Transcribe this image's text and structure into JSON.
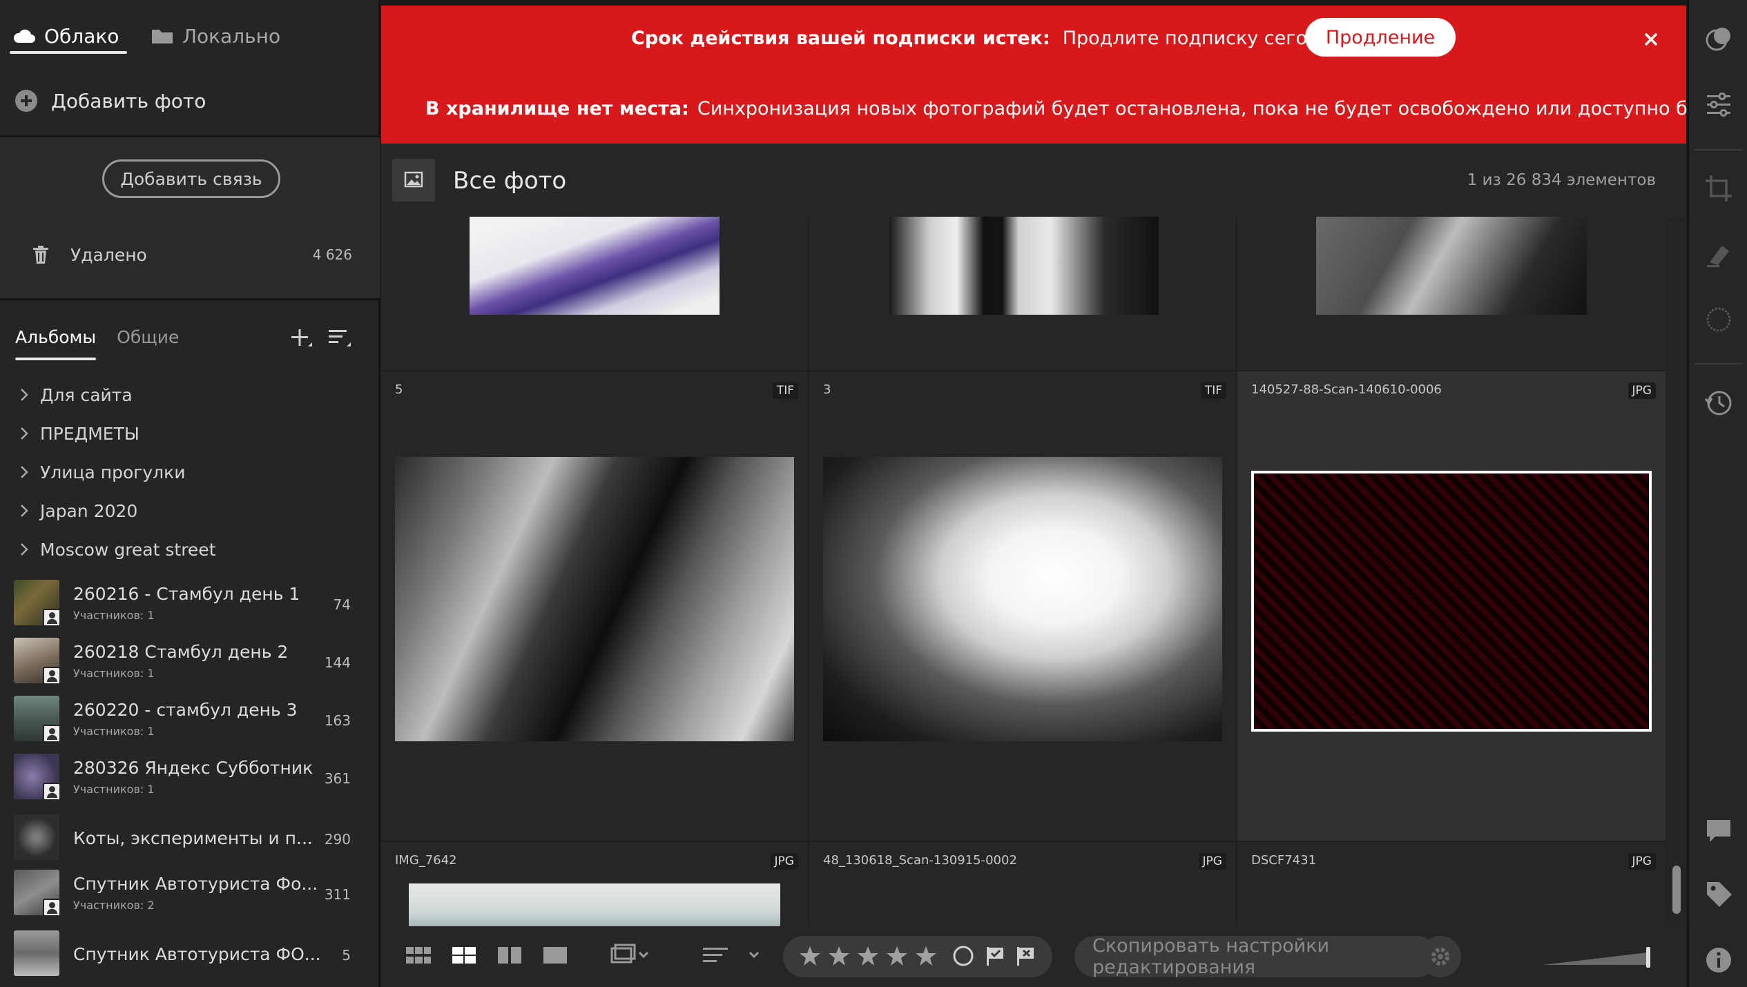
{
  "sidebar": {
    "tabs": [
      {
        "label": "Облако",
        "icon": "cloud-icon",
        "active": true
      },
      {
        "label": "Локально",
        "icon": "folder-icon",
        "active": false
      }
    ],
    "add_photo": "Добавить фото",
    "add_link": "Добавить связь",
    "deleted": {
      "label": "Удалено",
      "count": "4 626"
    },
    "album_tabs": [
      {
        "label": "Альбомы",
        "active": true
      },
      {
        "label": "Общие",
        "active": false
      }
    ],
    "folders": [
      "Для сайта",
      "ПРЕДМЕТЫ",
      "Улица прогулки",
      "Japan 2020",
      "Moscow great street"
    ],
    "albums": [
      {
        "name": "260216 - Стамбул день 1",
        "members": "Участников: 1",
        "count": "74"
      },
      {
        "name": "260218 Стамбул день 2",
        "members": "Участников: 1",
        "count": "144"
      },
      {
        "name": "260220 - стамбул день 3",
        "members": "Участников: 1",
        "count": "163"
      },
      {
        "name": "280326 Яндекс Субботник",
        "members": "Участников: 1",
        "count": "361"
      },
      {
        "name": "Коты, эксперименты и п...",
        "members": "",
        "count": "290"
      },
      {
        "name": "Спутник Автотуриста Фо...",
        "members": "Участников: 2",
        "count": "311"
      },
      {
        "name": "Спутник Автотуриста ФО...",
        "members": "",
        "count": "5"
      }
    ]
  },
  "banner": {
    "expired_title": "Срок действия вашей подписки истек:",
    "expired_text": "Продлите подписку сегодня.",
    "renew_button": "Продление",
    "storage_title": "В хранилище нет места:",
    "storage_text": "Синхронизация новых фотографий будет остановлена, пока не будет освобождено или доступно больше места"
  },
  "main": {
    "title": "Все фото",
    "item_count": "1 из 26 834 элементов",
    "grid": {
      "row2": [
        {
          "name": "5",
          "type": "TIF"
        },
        {
          "name": "3",
          "type": "TIF"
        },
        {
          "name": "140527-88-Scan-140610-0006",
          "type": "JPG"
        }
      ],
      "row3": [
        {
          "name": "IMG_7642",
          "type": "JPG"
        },
        {
          "name": "48_130618_Scan-130915-0002",
          "type": "JPG"
        },
        {
          "name": "DSCF7431",
          "type": "JPG"
        }
      ]
    }
  },
  "bottom_bar": {
    "copy_settings_placeholder": "Скопировать настройки редактирования"
  },
  "colors": {
    "banner": "#d7191c",
    "sidebar": "#252525",
    "panel": "#262626"
  }
}
